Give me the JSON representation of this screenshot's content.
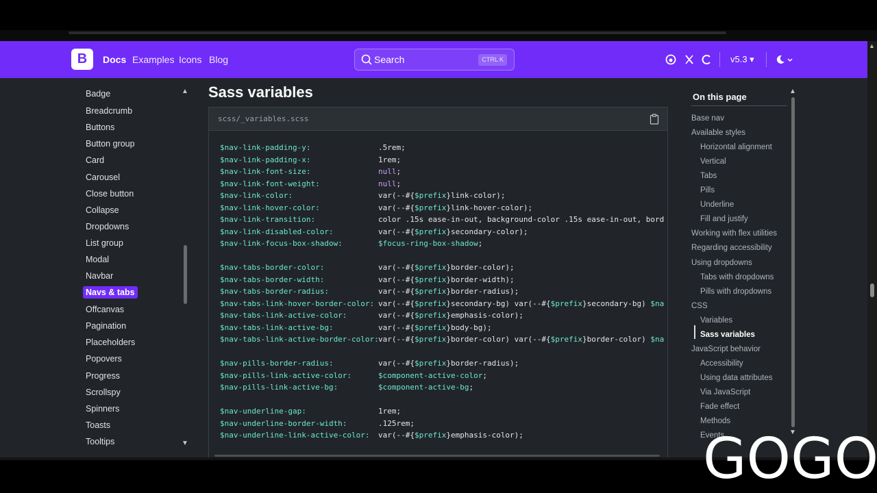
{
  "navbar": {
    "brand_letter": "B",
    "links": [
      "Docs",
      "Examples",
      "Icons",
      "Blog"
    ],
    "search": {
      "label": "Search",
      "shortcut": "CTRL K"
    },
    "version": "v5.3 ▾",
    "icons": [
      "github-icon",
      "x-icon",
      "opencollective-icon",
      "theme-toggle-icon"
    ]
  },
  "sidebar": {
    "items": [
      "Badge",
      "Breadcrumb",
      "Buttons",
      "Button group",
      "Card",
      "Carousel",
      "Close button",
      "Collapse",
      "Dropdowns",
      "List group",
      "Modal",
      "Navbar",
      "Navs & tabs",
      "Offcanvas",
      "Pagination",
      "Placeholders",
      "Popovers",
      "Progress",
      "Scrollspy",
      "Spinners",
      "Toasts",
      "Tooltips"
    ],
    "active": "Navs & tabs"
  },
  "content": {
    "title": "Sass variables",
    "filename": "scss/_variables.scss",
    "code_lines": [
      {
        "var": "$nav-link-padding-y:",
        "val": [
          [
            ".5rem;",
            "plain"
          ]
        ]
      },
      {
        "var": "$nav-link-padding-x:",
        "val": [
          [
            "1rem;",
            "plain"
          ]
        ]
      },
      {
        "var": "$nav-link-font-size:",
        "val": [
          [
            "null",
            "kw"
          ],
          [
            ";",
            "plain"
          ]
        ]
      },
      {
        "var": "$nav-link-font-weight:",
        "val": [
          [
            "null",
            "kw"
          ],
          [
            ";",
            "plain"
          ]
        ]
      },
      {
        "var": "$nav-link-color:",
        "val": [
          [
            "var(--#{",
            "plain"
          ],
          [
            "$prefix",
            "interp"
          ],
          [
            "}link-color);",
            "plain"
          ]
        ]
      },
      {
        "var": "$nav-link-hover-color:",
        "val": [
          [
            "var(--#{",
            "plain"
          ],
          [
            "$prefix",
            "interp"
          ],
          [
            "}link-hover-color);",
            "plain"
          ]
        ]
      },
      {
        "var": "$nav-link-transition:",
        "val": [
          [
            "color .15s ease-in-out, background-color .15s ease-in-out, bord",
            "plain"
          ]
        ]
      },
      {
        "var": "$nav-link-disabled-color:",
        "val": [
          [
            "var(--#{",
            "plain"
          ],
          [
            "$prefix",
            "interp"
          ],
          [
            "}secondary-color);",
            "plain"
          ]
        ]
      },
      {
        "var": "$nav-link-focus-box-shadow:",
        "val": [
          [
            "$focus-ring-box-shadow",
            "interp"
          ],
          [
            ";",
            "plain"
          ]
        ]
      },
      {
        "var": "",
        "val": []
      },
      {
        "var": "$nav-tabs-border-color:",
        "val": [
          [
            "var(--#{",
            "plain"
          ],
          [
            "$prefix",
            "interp"
          ],
          [
            "}border-color);",
            "plain"
          ]
        ]
      },
      {
        "var": "$nav-tabs-border-width:",
        "val": [
          [
            "var(--#{",
            "plain"
          ],
          [
            "$prefix",
            "interp"
          ],
          [
            "}border-width);",
            "plain"
          ]
        ]
      },
      {
        "var": "$nav-tabs-border-radius:",
        "val": [
          [
            "var(--#{",
            "plain"
          ],
          [
            "$prefix",
            "interp"
          ],
          [
            "}border-radius);",
            "plain"
          ]
        ]
      },
      {
        "var": "$nav-tabs-link-hover-border-color:",
        "val": [
          [
            "var(--#{",
            "plain"
          ],
          [
            "$prefix",
            "interp"
          ],
          [
            "}secondary-bg) var(--#{",
            "plain"
          ],
          [
            "$prefix",
            "interp"
          ],
          [
            "}secondary-bg) ",
            "plain"
          ],
          [
            "$na",
            "interp"
          ]
        ]
      },
      {
        "var": "$nav-tabs-link-active-color:",
        "val": [
          [
            "var(--#{",
            "plain"
          ],
          [
            "$prefix",
            "interp"
          ],
          [
            "}emphasis-color);",
            "plain"
          ]
        ]
      },
      {
        "var": "$nav-tabs-link-active-bg:",
        "val": [
          [
            "var(--#{",
            "plain"
          ],
          [
            "$prefix",
            "interp"
          ],
          [
            "}body-bg);",
            "plain"
          ]
        ]
      },
      {
        "var": "$nav-tabs-link-active-border-color:",
        "val": [
          [
            "var(--#{",
            "plain"
          ],
          [
            "$prefix",
            "interp"
          ],
          [
            "}border-color) var(--#{",
            "plain"
          ],
          [
            "$prefix",
            "interp"
          ],
          [
            "}border-color) ",
            "plain"
          ],
          [
            "$na",
            "interp"
          ]
        ]
      },
      {
        "var": "",
        "val": []
      },
      {
        "var": "$nav-pills-border-radius:",
        "val": [
          [
            "var(--#{",
            "plain"
          ],
          [
            "$prefix",
            "interp"
          ],
          [
            "}border-radius);",
            "plain"
          ]
        ]
      },
      {
        "var": "$nav-pills-link-active-color:",
        "val": [
          [
            "$component-active-color",
            "interp"
          ],
          [
            ";",
            "plain"
          ]
        ]
      },
      {
        "var": "$nav-pills-link-active-bg:",
        "val": [
          [
            "$component-active-bg",
            "interp"
          ],
          [
            ";",
            "plain"
          ]
        ]
      },
      {
        "var": "",
        "val": []
      },
      {
        "var": "$nav-underline-gap:",
        "val": [
          [
            "1rem;",
            "plain"
          ]
        ]
      },
      {
        "var": "$nav-underline-border-width:",
        "val": [
          [
            ".125rem;",
            "plain"
          ]
        ]
      },
      {
        "var": "$nav-underline-link-active-color:",
        "val": [
          [
            "var(--#{",
            "plain"
          ],
          [
            "$prefix",
            "interp"
          ],
          [
            "}emphasis-color);",
            "plain"
          ]
        ]
      }
    ]
  },
  "toc": {
    "title": "On this page",
    "items": [
      {
        "label": "Base nav",
        "level": 1
      },
      {
        "label": "Available styles",
        "level": 1
      },
      {
        "label": "Horizontal alignment",
        "level": 2
      },
      {
        "label": "Vertical",
        "level": 2
      },
      {
        "label": "Tabs",
        "level": 2
      },
      {
        "label": "Pills",
        "level": 2
      },
      {
        "label": "Underline",
        "level": 2
      },
      {
        "label": "Fill and justify",
        "level": 2
      },
      {
        "label": "Working with flex utilities",
        "level": 1
      },
      {
        "label": "Regarding accessibility",
        "level": 1
      },
      {
        "label": "Using dropdowns",
        "level": 1
      },
      {
        "label": "Tabs with dropdowns",
        "level": 2
      },
      {
        "label": "Pills with dropdowns",
        "level": 2
      },
      {
        "label": "CSS",
        "level": 1
      },
      {
        "label": "Variables",
        "level": 2
      },
      {
        "label": "Sass variables",
        "level": 2
      },
      {
        "label": "JavaScript behavior",
        "level": 1
      },
      {
        "label": "Accessibility",
        "level": 2
      },
      {
        "label": "Using data attributes",
        "level": 2
      },
      {
        "label": "Via JavaScript",
        "level": 2
      },
      {
        "label": "Fade effect",
        "level": 2
      },
      {
        "label": "Methods",
        "level": 2
      },
      {
        "label": "Events",
        "level": 2
      }
    ],
    "active": "Sass variables"
  },
  "watermark": "GOGO",
  "colors": {
    "brand_purple": "#712cf9",
    "background": "#212529",
    "code_variable": "#6ee7d0",
    "code_keyword": "#c99cff"
  }
}
